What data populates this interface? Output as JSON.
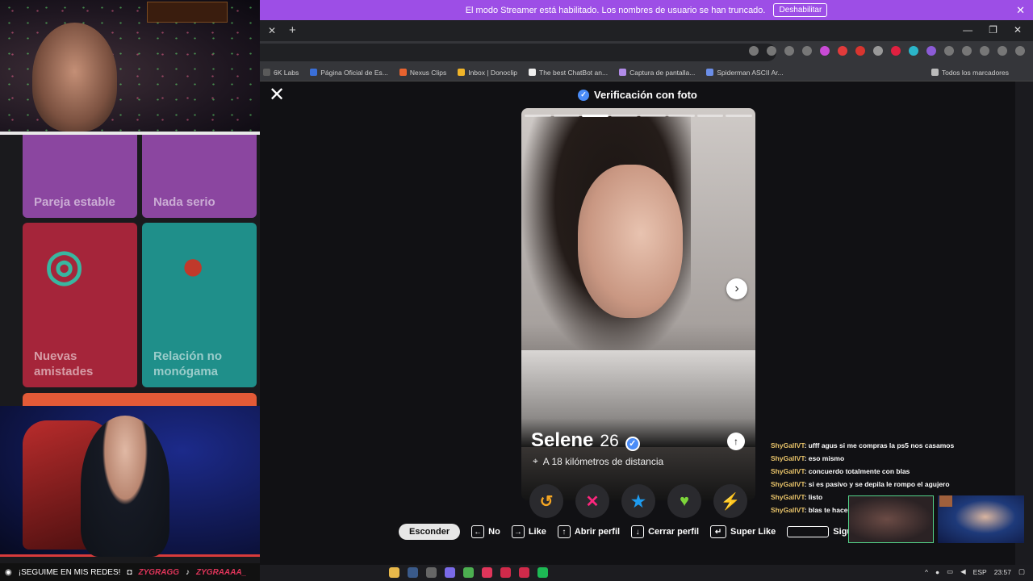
{
  "banner": {
    "text": "El modo Streamer está habilitado. Los nombres de usuario se han truncado.",
    "button": "Deshabilitar",
    "close": "✕"
  },
  "browser": {
    "tab_close": "✕",
    "new_tab": "+",
    "window_controls": [
      "—",
      "❐",
      "✕"
    ],
    "bookmarks": [
      "6K Labs",
      "Página Oficial de Es...",
      "Nexus Clips",
      "Inbox | Donoclip",
      "The best ChatBot an...",
      "Captura de pantalla...",
      "Spiderman ASCII Ar..."
    ],
    "all_bookmarks": "Todos los marcadores"
  },
  "overlay": {
    "tiles": [
      "Pareja estable",
      "Nada serio",
      "Nuevas amistades",
      "Relación no monógama"
    ],
    "social_text": "¡SEGUIME EN MIS REDES!",
    "handle_1": "ZYGRAGG",
    "handle_2": "ZYGRAAAA_"
  },
  "profile": {
    "header": "Verificación con foto",
    "name": "Selene",
    "age": "26",
    "distance": "A 18 kilómetros de distancia",
    "photo_count": 8,
    "current_photo": 3
  },
  "actions": [
    "rewind-icon",
    "nope-icon",
    "super-like-icon",
    "like-icon",
    "boost-icon"
  ],
  "hints": {
    "hide": "Esconder",
    "no": "No",
    "like": "Like",
    "open_profile": "Abrir perfil",
    "close_profile": "Cerrar perfil",
    "super_like": "Super Like",
    "next": "Siguie"
  },
  "chat": [
    {
      "user": "ShyGallVT",
      "text": ": ufff agus si me compras la ps5 nos casamos"
    },
    {
      "user": "ShyGallVT",
      "text": ": eso mismo"
    },
    {
      "user": "ShyGallVT",
      "text": ": concuerdo totalmente con blas"
    },
    {
      "user": "ShyGallVT",
      "text": ": si es pasivo y se depila le rompo el agujero"
    },
    {
      "user": "ShyGallVT",
      "text": ": listo"
    },
    {
      "user": "ShyGallVT",
      "text": ": blas te haces buto no hay de otra"
    }
  ],
  "taskbar": {
    "lang": "ESP",
    "time": "23:57"
  },
  "colors": {
    "banner": "#9d4ee6",
    "rewind": "#f5a623",
    "nope": "#fd267d",
    "super_like": "#1e9bf0",
    "like": "#7dd63a",
    "boost": "#a64dfd"
  }
}
